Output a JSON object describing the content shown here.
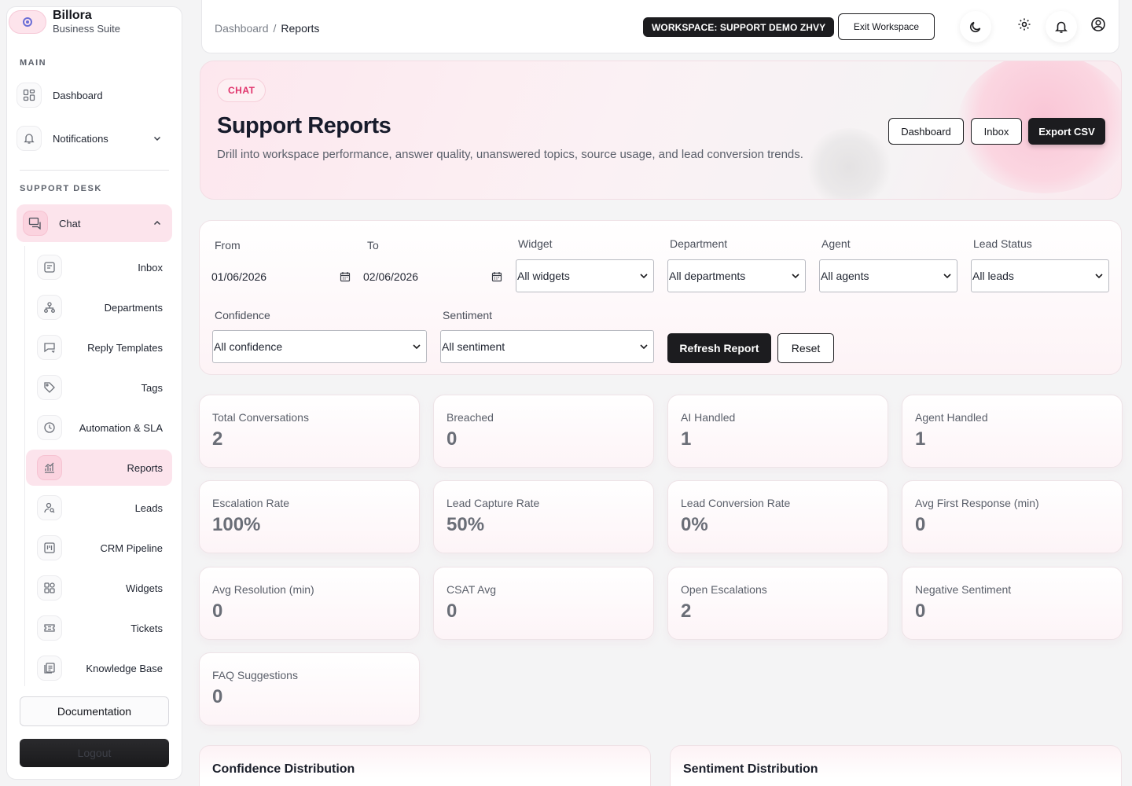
{
  "brand": {
    "name": "Billora",
    "subtitle": "Business Suite"
  },
  "sidebar": {
    "main_label": "MAIN",
    "main_items": [
      {
        "label": "Dashboard",
        "icon": "grid-icon"
      },
      {
        "label": "Notifications",
        "icon": "bell-icon"
      }
    ],
    "support_label": "SUPPORT DESK",
    "chat_label": "Chat",
    "chat_items": [
      {
        "label": "Inbox",
        "icon": "message-icon"
      },
      {
        "label": "Departments",
        "icon": "org-icon"
      },
      {
        "label": "Reply Templates",
        "icon": "reply-icon"
      },
      {
        "label": "Tags",
        "icon": "tag-icon"
      },
      {
        "label": "Automation & SLA",
        "icon": "clock-icon"
      },
      {
        "label": "Reports",
        "icon": "chart-icon",
        "active": true
      },
      {
        "label": "Leads",
        "icon": "user-search-icon"
      },
      {
        "label": "CRM Pipeline",
        "icon": "pipeline-icon"
      },
      {
        "label": "Widgets",
        "icon": "widgets-icon"
      },
      {
        "label": "Tickets",
        "icon": "ticket-icon"
      },
      {
        "label": "Knowledge Base",
        "icon": "book-icon"
      }
    ],
    "documentation_label": "Documentation",
    "logout_label": "Logout"
  },
  "topbar": {
    "breadcrumb_root": "Dashboard",
    "breadcrumb_sep": "/",
    "breadcrumb_current": "Reports",
    "workspace_badge": "WORKSPACE: SUPPORT DEMO ZHVY",
    "exit_label": "Exit Workspace"
  },
  "hero": {
    "tag": "CHAT",
    "title": "Support Reports",
    "description": "Drill into workspace performance, answer quality, unanswered topics, source usage, and lead conversion trends.",
    "dashboard_label": "Dashboard",
    "inbox_label": "Inbox",
    "export_label": "Export CSV"
  },
  "filters": {
    "from_label": "From",
    "from_value": "01/06/2026",
    "to_label": "To",
    "to_value": "02/06/2026",
    "widget_label": "Widget",
    "widget_value": "All widgets",
    "department_label": "Department",
    "department_value": "All departments",
    "agent_label": "Agent",
    "agent_value": "All agents",
    "lead_status_label": "Lead Status",
    "lead_status_value": "All leads",
    "confidence_label": "Confidence",
    "confidence_value": "All confidence",
    "sentiment_label": "Sentiment",
    "sentiment_value": "All sentiment",
    "refresh_label": "Refresh Report",
    "reset_label": "Reset"
  },
  "stats": [
    {
      "label": "Total Conversations",
      "value": "2"
    },
    {
      "label": "Breached",
      "value": "0"
    },
    {
      "label": "AI Handled",
      "value": "1"
    },
    {
      "label": "Agent Handled",
      "value": "1"
    },
    {
      "label": "Escalation Rate",
      "value": "100%"
    },
    {
      "label": "Lead Capture Rate",
      "value": "50%"
    },
    {
      "label": "Lead Conversion Rate",
      "value": "0%"
    },
    {
      "label": "Avg First Response (min)",
      "value": "0"
    },
    {
      "label": "Avg Resolution (min)",
      "value": "0"
    },
    {
      "label": "CSAT Avg",
      "value": "0"
    },
    {
      "label": "Open Escalations",
      "value": "2"
    },
    {
      "label": "Negative Sentiment",
      "value": "0"
    },
    {
      "label": "FAQ Suggestions",
      "value": "0"
    }
  ],
  "panels": {
    "confidence_title": "Confidence Distribution",
    "sentiment_title": "Sentiment Distribution"
  },
  "colors": {
    "accent_pink": "#fce4ec",
    "tag_pink": "#e0336b",
    "dark": "#1c1c1f"
  }
}
